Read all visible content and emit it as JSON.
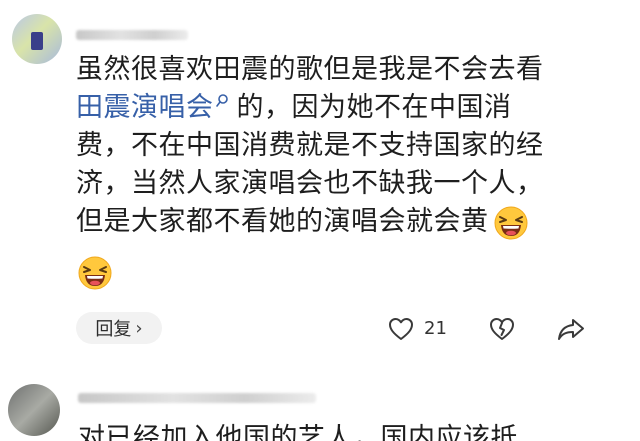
{
  "comment1": {
    "line1": "虽然很喜欢田震的歌但是我是不会去看",
    "keyword_link": "田震演唱会",
    "line2_rest": "的，因为她不在中国消",
    "line3": "费，不在中国消费就是不支持国家的经",
    "line4": "济，当然人家演唱会也不缺我一个人，",
    "line5": "但是大家都不看她的演唱会就会黄",
    "emoji_inline": "laughing-emoji",
    "emoji_solo": "laughing-emoji"
  },
  "actions": {
    "reply_label": "回复",
    "reply_chevron": "›",
    "like_count": "21",
    "like_icon": "heart-icon",
    "dislike_icon": "broken-heart-icon",
    "share_icon": "share-icon"
  },
  "comment2": {
    "text": "对已经加入他国的艺人，国内应该抵"
  },
  "colors": {
    "text": "#1e1e1e",
    "link": "#3760a8",
    "reply_bg": "#f2f2f2"
  }
}
